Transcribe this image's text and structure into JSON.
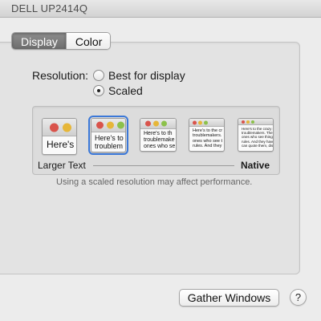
{
  "window": {
    "title": "DELL UP2414Q"
  },
  "tabs": [
    {
      "label": "Display",
      "active": true
    },
    {
      "label": "Color",
      "active": false
    }
  ],
  "resolution": {
    "label": "Resolution:",
    "options": [
      {
        "label": "Best for display",
        "selected": false
      },
      {
        "label": "Scaled",
        "selected": true
      }
    ]
  },
  "scaled_options": {
    "thumbnails": [
      {
        "text": "Here's",
        "selected": false
      },
      {
        "text": "Here's to\ntroublem",
        "selected": true
      },
      {
        "text": "Here's to th\ntroublemake\nones who se",
        "selected": false
      },
      {
        "text": "Here's to the cr\ntroublemakers.\nones who see t\nrules. And they",
        "selected": false
      },
      {
        "text": "Here's to the crazy one\ntroublemakers. The ro\nones who see things d\nrules. And they have n\ncan quote them, disag",
        "selected": false
      }
    ],
    "larger_text_label": "Larger Text",
    "native_label": "Native",
    "note": "Using a scaled resolution may affect performance."
  },
  "buttons": {
    "gather_windows": "Gather Windows",
    "help": "?"
  },
  "colors": {
    "accent": "#3b78d8",
    "tab_active": "#7d7d7d",
    "close": "#d9534b",
    "minimize": "#e6b638",
    "zoom": "#8cc14a"
  }
}
